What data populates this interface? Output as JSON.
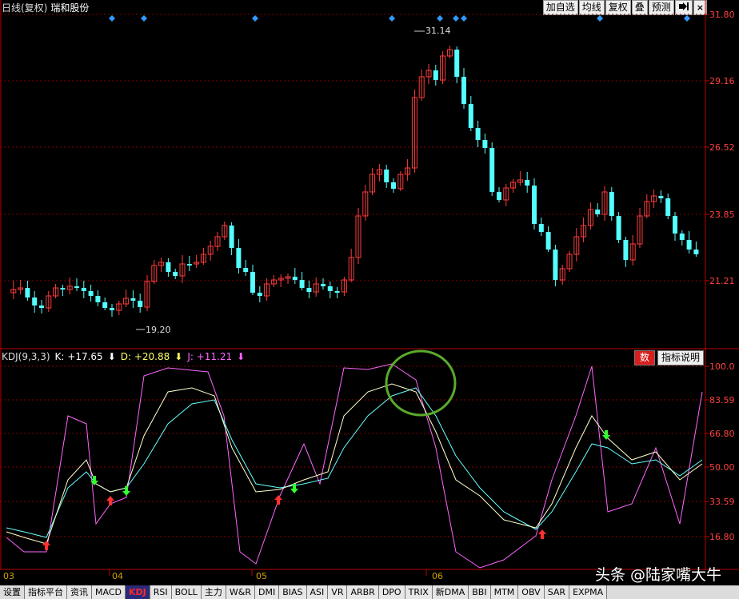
{
  "header": {
    "period": "日线(复权)",
    "stock_name": "瑞和股份"
  },
  "toolbar": {
    "buttons": [
      "加自选",
      "均线",
      "复权",
      "叠",
      "预测"
    ],
    "nav_icon": "arrow-bar-right-icon",
    "close": "×"
  },
  "price_axis": {
    "labels": [
      "31.80",
      "29.16",
      "26.52",
      "23.85",
      "21.21"
    ]
  },
  "price_annotations": {
    "high": "31.14",
    "low": "19.20"
  },
  "kdj": {
    "title": "KDJ(9,3,3)",
    "k_label": "K: +17.65",
    "d_label": "D: +20.88",
    "j_label": "J: +11.21",
    "buttons": {
      "shu": "数",
      "explain": "指标说明"
    },
    "axis_labels": [
      "100.0",
      "83.59",
      "66.80",
      "50.00",
      "33.59",
      "16.80"
    ]
  },
  "x_axis": {
    "labels": [
      "03",
      "04",
      "05",
      "06"
    ]
  },
  "tabs": [
    "设置",
    "指标平台",
    "资讯",
    "MACD",
    "KDJ",
    "RSI",
    "BOLL",
    "主力",
    "W&R",
    "DMI",
    "BIAS",
    "ASI",
    "VR",
    "ARBR",
    "DPO",
    "TRIX",
    "新DMA",
    "BBI",
    "MTM",
    "OBV",
    "SAR",
    "EXPMA"
  ],
  "active_tab": "KDJ",
  "watermark": "头条 @陆家嘴大牛",
  "colors": {
    "up": "#ff3b3b",
    "down": "#54ffff",
    "k": "#ffffff",
    "d": "#ffff66",
    "j": "#ff66ff",
    "marker": "#3399ff",
    "grid": "#8a0000",
    "circle": "#5aaa2a"
  }
}
